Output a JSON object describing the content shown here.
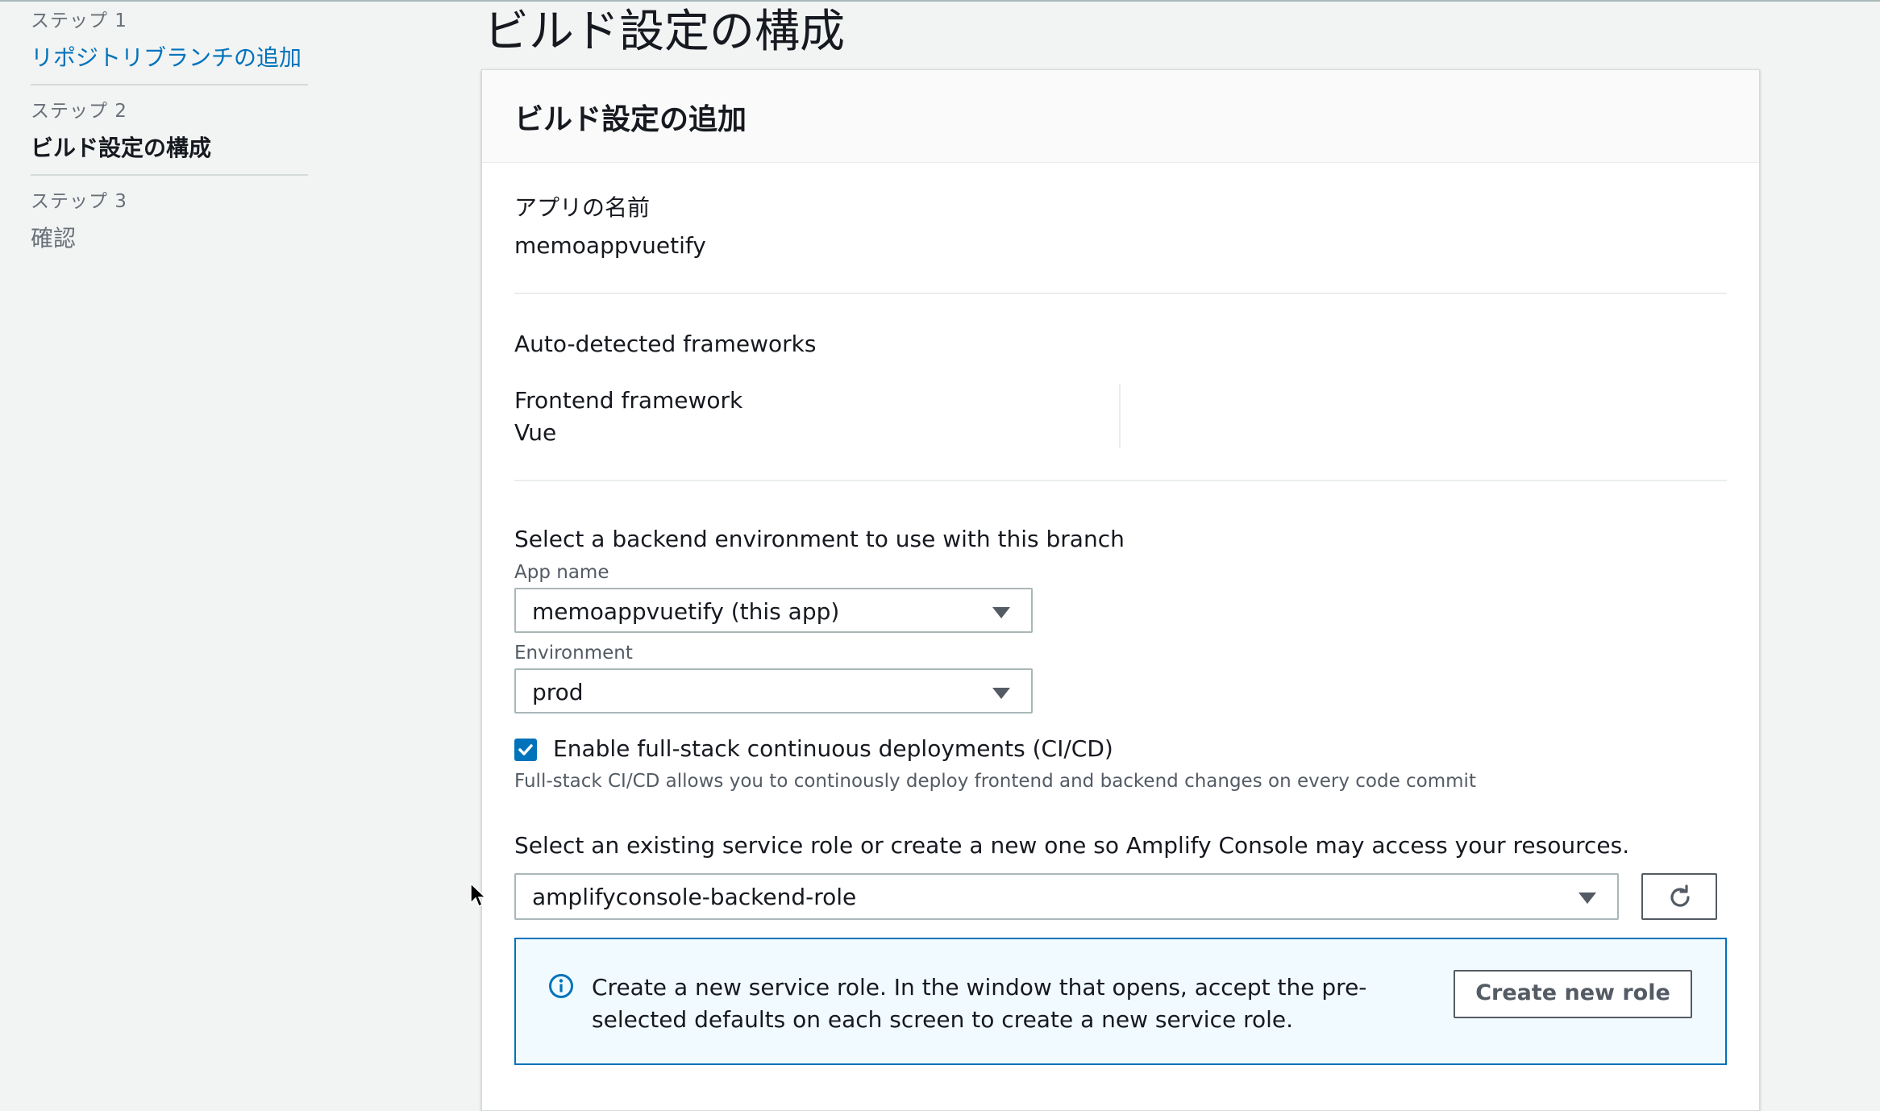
{
  "sidebar": {
    "steps": [
      {
        "number": "ステップ 1",
        "title": "リポジトリブランチの追加"
      },
      {
        "number": "ステップ 2",
        "title": "ビルド設定の構成"
      },
      {
        "number": "ステップ 3",
        "title": "確認"
      }
    ]
  },
  "page": {
    "title": "ビルド設定の構成"
  },
  "card": {
    "header": "ビルド設定の追加",
    "app_name_label": "アプリの名前",
    "app_name_value": "memoappvuetify",
    "frameworks_heading": "Auto-detected frameworks",
    "frontend_label": "Frontend framework",
    "frontend_value": "Vue",
    "backend_heading": "Select a backend environment to use with this branch",
    "app_select_label": "App name",
    "app_select_value": "memoappvuetify (this app)",
    "env_select_label": "Environment",
    "env_select_value": "prod",
    "cicd_checkbox_label": "Enable full-stack continuous deployments (CI/CD)",
    "cicd_checked": true,
    "cicd_description": "Full-stack CI/CD allows you to continously deploy frontend and backend changes on every code commit",
    "service_role_heading": "Select an existing service role or create a new one so Amplify Console may access your resources.",
    "service_role_value": "amplifyconsole-backend-role",
    "info_text": "Create a new service role. In the window that opens, accept the pre-selected defaults on each screen to create a new service role.",
    "create_role_button": "Create new role"
  },
  "colors": {
    "link": "#0073bb",
    "accent": "#0073bb",
    "info_bg": "#f1faff",
    "page_bg": "#f2f3f3"
  },
  "icons": [
    "refresh-icon",
    "info-icon",
    "check-icon",
    "caret-down-icon",
    "mouse-cursor-icon"
  ]
}
